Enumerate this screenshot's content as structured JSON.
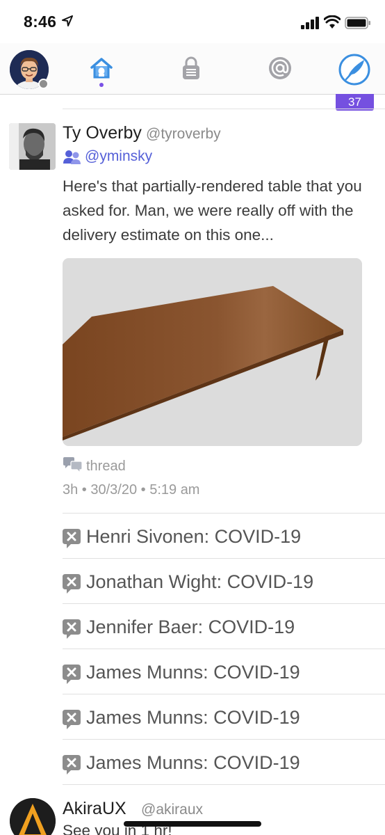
{
  "status_bar": {
    "time": "8:46"
  },
  "nav": {
    "unread_count": "37"
  },
  "tweet": {
    "author_name": "Ty Overby",
    "author_handle": "@tyroverby",
    "retweeted_by": "@yminsky",
    "text": "Here's that partially-rendered table that you asked for.  Man, we were really off with the delivery estimate on this one...",
    "thread_label": "thread",
    "meta": "3h • 30/3/20 • 5:19 am"
  },
  "muted_items": [
    {
      "label": "Henri Sivonen: COVID-19"
    },
    {
      "label": "Jonathan Wight: COVID-19"
    },
    {
      "label": "Jennifer Baer: COVID-19"
    },
    {
      "label": "James Munns: COVID-19"
    },
    {
      "label": "James Munns: COVID-19"
    },
    {
      "label": "James Munns: COVID-19"
    }
  ],
  "next_tweet": {
    "author_name": "AkiraUX",
    "author_handle": "@akiraux",
    "text": "See you in 1 hr!"
  },
  "colors": {
    "accent": "#7550e0",
    "link": "#5560d8",
    "home_tab": "#3b8fe0",
    "inactive_tab": "#9a9aa0"
  },
  "icons": {
    "location": "location-arrow-icon",
    "signal": "cellular-signal-icon",
    "wifi": "wifi-icon",
    "battery": "battery-icon",
    "home": "home-icon",
    "messages": "lock-messages-icon",
    "mentions": "at-sign-icon",
    "compose": "feather-compose-icon",
    "retweet": "retweet-people-icon",
    "thread": "thread-bubbles-icon",
    "muted": "muted-bubble-icon"
  }
}
